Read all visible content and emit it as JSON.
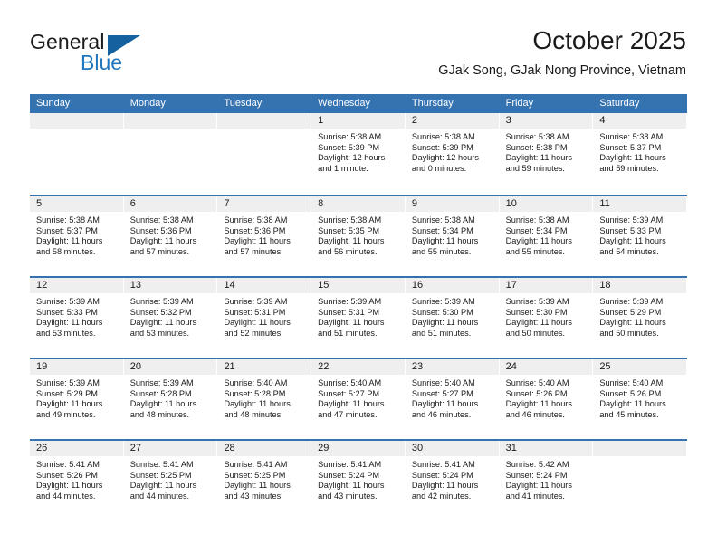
{
  "brand": {
    "word_one": "General",
    "word_two": "Blue",
    "triangle_icon": "triangle-icon",
    "colors": {
      "dark_text": "#1c1c1c",
      "blue_text": "#2176bd",
      "triangle": "#15619f"
    }
  },
  "header": {
    "title": "October 2025",
    "subtitle": "GJak Song, GJak Nong Province, Vietnam"
  },
  "theme": {
    "header_blue": "#3572b0",
    "day_band_gray": "#efefef",
    "text": "#1a1a1a"
  },
  "weekdays": [
    "Sunday",
    "Monday",
    "Tuesday",
    "Wednesday",
    "Thursday",
    "Friday",
    "Saturday"
  ],
  "weeks": [
    [
      {
        "day": "",
        "empty": true
      },
      {
        "day": "",
        "empty": true
      },
      {
        "day": "",
        "empty": true
      },
      {
        "day": "1",
        "sunrise": "Sunrise: 5:38 AM",
        "sunset": "Sunset: 5:39 PM",
        "daylight_1": "Daylight: 12 hours",
        "daylight_2": "and 1 minute."
      },
      {
        "day": "2",
        "sunrise": "Sunrise: 5:38 AM",
        "sunset": "Sunset: 5:39 PM",
        "daylight_1": "Daylight: 12 hours",
        "daylight_2": "and 0 minutes."
      },
      {
        "day": "3",
        "sunrise": "Sunrise: 5:38 AM",
        "sunset": "Sunset: 5:38 PM",
        "daylight_1": "Daylight: 11 hours",
        "daylight_2": "and 59 minutes."
      },
      {
        "day": "4",
        "sunrise": "Sunrise: 5:38 AM",
        "sunset": "Sunset: 5:37 PM",
        "daylight_1": "Daylight: 11 hours",
        "daylight_2": "and 59 minutes."
      }
    ],
    [
      {
        "day": "5",
        "sunrise": "Sunrise: 5:38 AM",
        "sunset": "Sunset: 5:37 PM",
        "daylight_1": "Daylight: 11 hours",
        "daylight_2": "and 58 minutes."
      },
      {
        "day": "6",
        "sunrise": "Sunrise: 5:38 AM",
        "sunset": "Sunset: 5:36 PM",
        "daylight_1": "Daylight: 11 hours",
        "daylight_2": "and 57 minutes."
      },
      {
        "day": "7",
        "sunrise": "Sunrise: 5:38 AM",
        "sunset": "Sunset: 5:36 PM",
        "daylight_1": "Daylight: 11 hours",
        "daylight_2": "and 57 minutes."
      },
      {
        "day": "8",
        "sunrise": "Sunrise: 5:38 AM",
        "sunset": "Sunset: 5:35 PM",
        "daylight_1": "Daylight: 11 hours",
        "daylight_2": "and 56 minutes."
      },
      {
        "day": "9",
        "sunrise": "Sunrise: 5:38 AM",
        "sunset": "Sunset: 5:34 PM",
        "daylight_1": "Daylight: 11 hours",
        "daylight_2": "and 55 minutes."
      },
      {
        "day": "10",
        "sunrise": "Sunrise: 5:38 AM",
        "sunset": "Sunset: 5:34 PM",
        "daylight_1": "Daylight: 11 hours",
        "daylight_2": "and 55 minutes."
      },
      {
        "day": "11",
        "sunrise": "Sunrise: 5:39 AM",
        "sunset": "Sunset: 5:33 PM",
        "daylight_1": "Daylight: 11 hours",
        "daylight_2": "and 54 minutes."
      }
    ],
    [
      {
        "day": "12",
        "sunrise": "Sunrise: 5:39 AM",
        "sunset": "Sunset: 5:33 PM",
        "daylight_1": "Daylight: 11 hours",
        "daylight_2": "and 53 minutes."
      },
      {
        "day": "13",
        "sunrise": "Sunrise: 5:39 AM",
        "sunset": "Sunset: 5:32 PM",
        "daylight_1": "Daylight: 11 hours",
        "daylight_2": "and 53 minutes."
      },
      {
        "day": "14",
        "sunrise": "Sunrise: 5:39 AM",
        "sunset": "Sunset: 5:31 PM",
        "daylight_1": "Daylight: 11 hours",
        "daylight_2": "and 52 minutes."
      },
      {
        "day": "15",
        "sunrise": "Sunrise: 5:39 AM",
        "sunset": "Sunset: 5:31 PM",
        "daylight_1": "Daylight: 11 hours",
        "daylight_2": "and 51 minutes."
      },
      {
        "day": "16",
        "sunrise": "Sunrise: 5:39 AM",
        "sunset": "Sunset: 5:30 PM",
        "daylight_1": "Daylight: 11 hours",
        "daylight_2": "and 51 minutes."
      },
      {
        "day": "17",
        "sunrise": "Sunrise: 5:39 AM",
        "sunset": "Sunset: 5:30 PM",
        "daylight_1": "Daylight: 11 hours",
        "daylight_2": "and 50 minutes."
      },
      {
        "day": "18",
        "sunrise": "Sunrise: 5:39 AM",
        "sunset": "Sunset: 5:29 PM",
        "daylight_1": "Daylight: 11 hours",
        "daylight_2": "and 50 minutes."
      }
    ],
    [
      {
        "day": "19",
        "sunrise": "Sunrise: 5:39 AM",
        "sunset": "Sunset: 5:29 PM",
        "daylight_1": "Daylight: 11 hours",
        "daylight_2": "and 49 minutes."
      },
      {
        "day": "20",
        "sunrise": "Sunrise: 5:39 AM",
        "sunset": "Sunset: 5:28 PM",
        "daylight_1": "Daylight: 11 hours",
        "daylight_2": "and 48 minutes."
      },
      {
        "day": "21",
        "sunrise": "Sunrise: 5:40 AM",
        "sunset": "Sunset: 5:28 PM",
        "daylight_1": "Daylight: 11 hours",
        "daylight_2": "and 48 minutes."
      },
      {
        "day": "22",
        "sunrise": "Sunrise: 5:40 AM",
        "sunset": "Sunset: 5:27 PM",
        "daylight_1": "Daylight: 11 hours",
        "daylight_2": "and 47 minutes."
      },
      {
        "day": "23",
        "sunrise": "Sunrise: 5:40 AM",
        "sunset": "Sunset: 5:27 PM",
        "daylight_1": "Daylight: 11 hours",
        "daylight_2": "and 46 minutes."
      },
      {
        "day": "24",
        "sunrise": "Sunrise: 5:40 AM",
        "sunset": "Sunset: 5:26 PM",
        "daylight_1": "Daylight: 11 hours",
        "daylight_2": "and 46 minutes."
      },
      {
        "day": "25",
        "sunrise": "Sunrise: 5:40 AM",
        "sunset": "Sunset: 5:26 PM",
        "daylight_1": "Daylight: 11 hours",
        "daylight_2": "and 45 minutes."
      }
    ],
    [
      {
        "day": "26",
        "sunrise": "Sunrise: 5:41 AM",
        "sunset": "Sunset: 5:26 PM",
        "daylight_1": "Daylight: 11 hours",
        "daylight_2": "and 44 minutes."
      },
      {
        "day": "27",
        "sunrise": "Sunrise: 5:41 AM",
        "sunset": "Sunset: 5:25 PM",
        "daylight_1": "Daylight: 11 hours",
        "daylight_2": "and 44 minutes."
      },
      {
        "day": "28",
        "sunrise": "Sunrise: 5:41 AM",
        "sunset": "Sunset: 5:25 PM",
        "daylight_1": "Daylight: 11 hours",
        "daylight_2": "and 43 minutes."
      },
      {
        "day": "29",
        "sunrise": "Sunrise: 5:41 AM",
        "sunset": "Sunset: 5:24 PM",
        "daylight_1": "Daylight: 11 hours",
        "daylight_2": "and 43 minutes."
      },
      {
        "day": "30",
        "sunrise": "Sunrise: 5:41 AM",
        "sunset": "Sunset: 5:24 PM",
        "daylight_1": "Daylight: 11 hours",
        "daylight_2": "and 42 minutes."
      },
      {
        "day": "31",
        "sunrise": "Sunrise: 5:42 AM",
        "sunset": "Sunset: 5:24 PM",
        "daylight_1": "Daylight: 11 hours",
        "daylight_2": "and 41 minutes."
      },
      {
        "day": "",
        "empty": true
      }
    ]
  ]
}
